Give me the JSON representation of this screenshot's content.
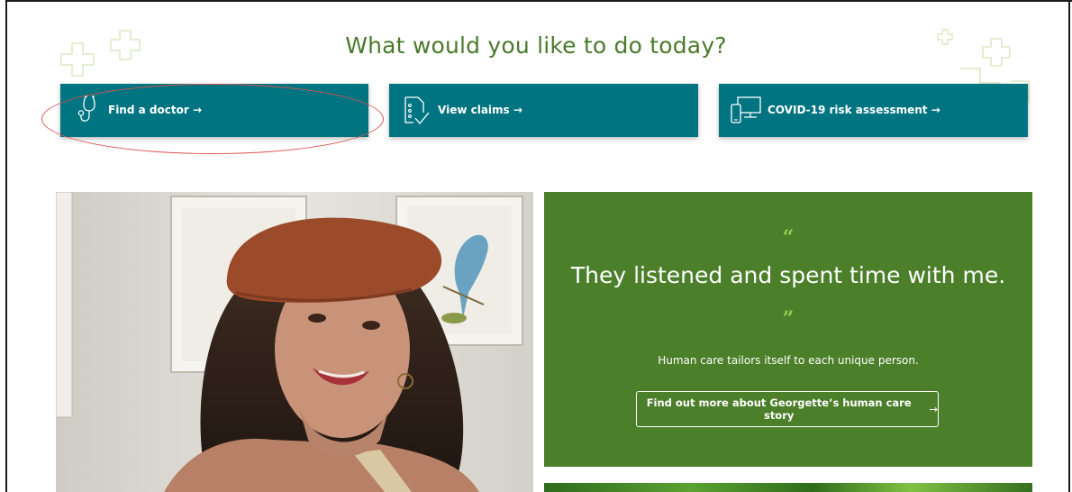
{
  "headline": "What would you like to do today?",
  "actions": [
    {
      "label": "Find a doctor",
      "arrow": "→",
      "icon": "stethoscope-icon"
    },
    {
      "label": "View claims",
      "arrow": "→",
      "icon": "claims-document-icon"
    },
    {
      "label": "COVID-19 risk assessment",
      "arrow": "→",
      "icon": "devices-icon"
    }
  ],
  "testimonial": {
    "open_quote": "“",
    "quote": "They listened and spent time with me.",
    "close_quote": "”",
    "subtext": "Human care tailors itself to each unique person.",
    "cta_label": "Find out more about Georgette’s human care story",
    "cta_arrow": "→"
  },
  "colors": {
    "heading_green": "#4a7a2b",
    "action_teal": "#007481",
    "testimonial_green": "#4b7f2a",
    "quote_mark_green": "#8fd14f",
    "annotation_red": "#d9534f"
  }
}
